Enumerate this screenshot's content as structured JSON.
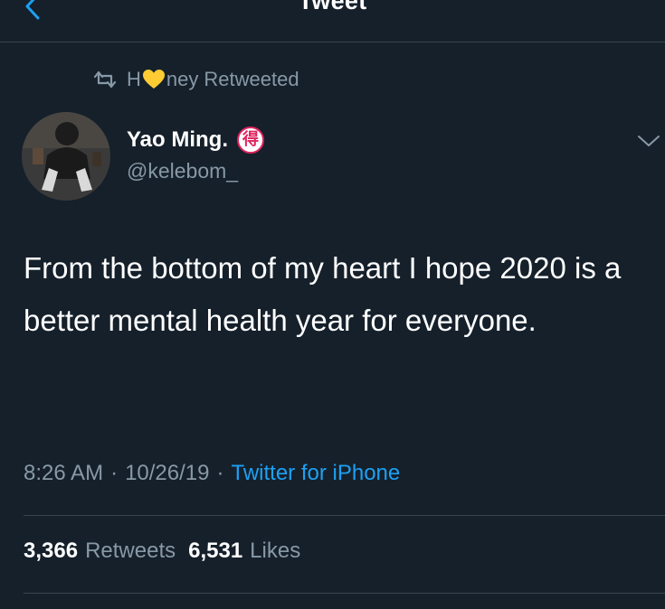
{
  "header": {
    "title": "Tweet",
    "back_icon": "chevron-left-icon"
  },
  "retweet_context": {
    "name_prefix": "H",
    "name_emoji": "yellow-heart",
    "name_suffix": "ney",
    "label": "Retweeted"
  },
  "author": {
    "name": "Yao Ming.",
    "badge_char": "得",
    "handle": "@kelebom_"
  },
  "tweet": {
    "text": "From the bottom of my heart I hope 2020 is a better mental health year for everyone.",
    "time": "8:26 AM",
    "date": "10/26/19",
    "separator": "·",
    "source": "Twitter for iPhone"
  },
  "stats": {
    "retweets_count": "3,366",
    "retweets_label": "Retweets",
    "likes_count": "6,531",
    "likes_label": "Likes"
  },
  "colors": {
    "background": "#15202b",
    "accent": "#1da1f2",
    "secondary_text": "#8899a6",
    "divider": "#38444d",
    "heart": "#ffcc33",
    "badge": "#e0245e"
  }
}
